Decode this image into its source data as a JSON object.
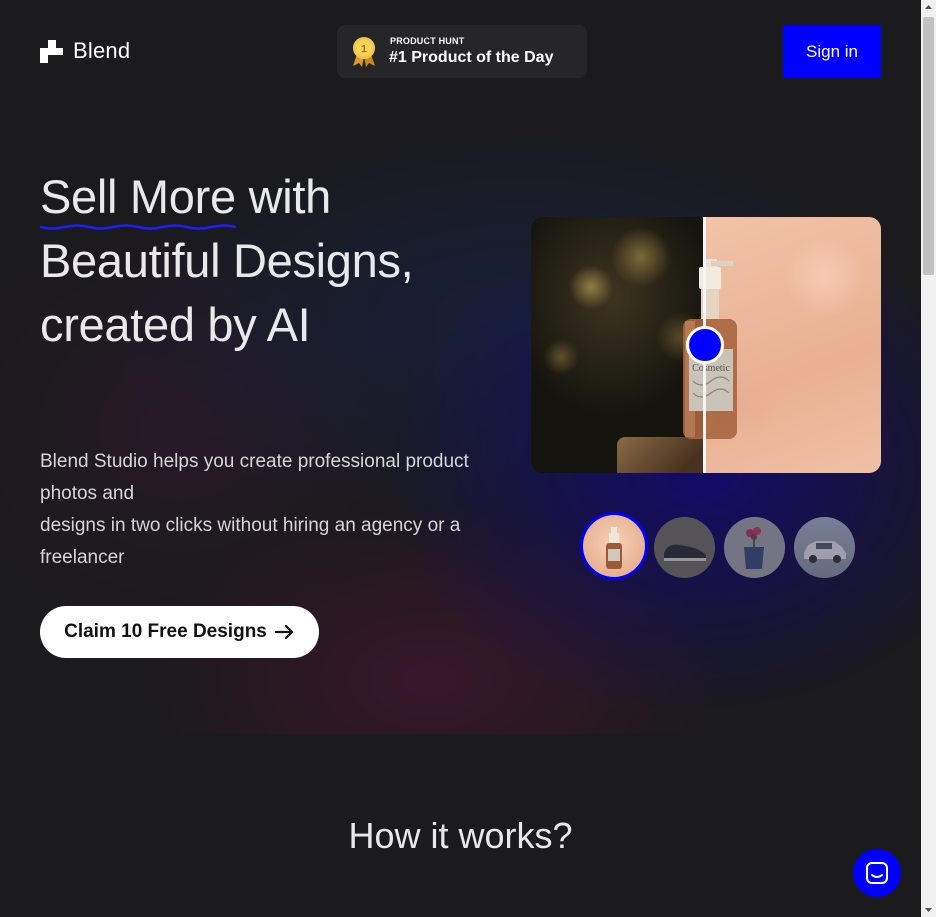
{
  "header": {
    "logo_text": "Blend",
    "badge": {
      "small_label": "PRODUCT HUNT",
      "big_label": "#1 Product of the Day",
      "medal_number": "1"
    },
    "signin_label": "Sign in"
  },
  "hero": {
    "headline_part1": "Sell More",
    "headline_part2": " with Beautiful Designs, created by AI",
    "subtext_line1": "Blend Studio helps you create professional product photos and",
    "subtext_line2": "designs in two clicks without hiring an agency or a freelancer",
    "cta_label": "Claim 10 Free Designs"
  },
  "preview": {
    "bottle_label": "Cosmetic",
    "thumbnails": [
      {
        "name": "cosmetic-bottle",
        "active": true
      },
      {
        "name": "shoe",
        "active": false
      },
      {
        "name": "flower-vase",
        "active": false
      },
      {
        "name": "car",
        "active": false
      }
    ]
  },
  "sections": {
    "how_it_works_title": "How it works?"
  },
  "icons": {
    "logo": "blend-logo-icon",
    "medal": "medal-icon",
    "arrow": "arrow-right-icon",
    "chat": "chat-icon"
  },
  "colors": {
    "accent": "#0000ff",
    "background": "#1b1a1c",
    "badge_bg": "#262528"
  }
}
